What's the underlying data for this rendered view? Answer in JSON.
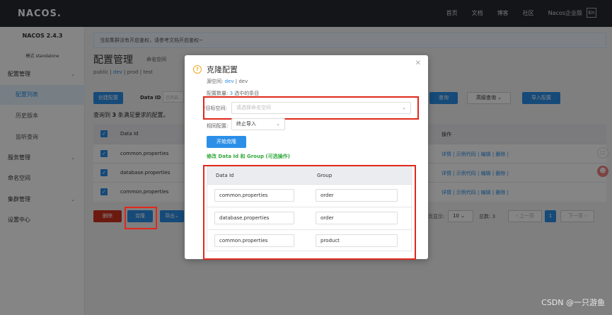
{
  "topbar": {
    "logo": "NACOS.",
    "nav": [
      "首页",
      "文档",
      "博客",
      "社区",
      "Nacos企业版"
    ],
    "lang": "En"
  },
  "sidebar": {
    "version": "NACOS 2.4.3",
    "mode": "模式 standalone",
    "items": [
      {
        "label": "配置管理"
      },
      {
        "label": "配置列表"
      },
      {
        "label": "历史版本"
      },
      {
        "label": "监听查询"
      },
      {
        "label": "服务管理"
      },
      {
        "label": "命名空间"
      },
      {
        "label": "集群管理"
      },
      {
        "label": "设置中心"
      }
    ]
  },
  "main": {
    "notice": "当前集群没有开启鉴权，请参考文档开启鉴权~",
    "title": "配置管理",
    "ns_label": "命名空间",
    "ns_tabs": [
      "public",
      "dev",
      "prod",
      "test"
    ],
    "create_btn": "创建配置",
    "data_id_label": "Data ID",
    "data_id_placeholder": "已开启模糊查询",
    "query_btn": "查询",
    "advanced_btn": "高级查询",
    "import_btn": "导入配置",
    "result_text_pre": "查询到",
    "result_count": "3",
    "result_text_post": "条满足要求的配置。",
    "table": {
      "col_dataid": "Data Id",
      "col_ops": "操作",
      "rows": [
        {
          "dataid": "common.properties",
          "ops": "详情 | 示例代码 | 编辑 | 删除 |"
        },
        {
          "dataid": "database.properties",
          "ops": "详情 | 示例代码 | 编辑 | 删除 |"
        },
        {
          "dataid": "common.properties",
          "ops": "详情 | 示例代码 | 编辑 | 删除 |"
        }
      ]
    },
    "delete_btn": "删除",
    "clone_btn": "克隆",
    "export_btn": "导出",
    "per_page_label": "每页显示:",
    "per_page_value": "10",
    "total_label": "总数: 3",
    "prev_btn": "上一页",
    "page_current": "1",
    "next_btn": "下一页"
  },
  "dialog": {
    "title": "克隆配置",
    "source_label": "源空间:",
    "source_ns": "dev",
    "source_ns_name": "dev",
    "count_label": "配置数量:",
    "count": "3",
    "count_suffix": "选中的条目",
    "target_label": "目标空间:",
    "target_placeholder": "请选择命名空间",
    "same_label": "相同配置:",
    "same_value": "终止导入",
    "start_btn": "开始克隆",
    "modify_text": "修改 Data Id 和 Group (可选操作)",
    "col_dataid": "Data Id",
    "col_group": "Group",
    "rows": [
      {
        "dataid": "common.properties",
        "group": "order"
      },
      {
        "dataid": "database.properties",
        "group": "order"
      },
      {
        "dataid": "common.properties",
        "group": "product"
      }
    ]
  },
  "watermark": "CSDN @一只游鱼",
  "colors": {
    "accent": "#2b8fe8",
    "danger": "#d0331f",
    "highlight_box": "#e0281c",
    "success_text": "#31a83b"
  }
}
